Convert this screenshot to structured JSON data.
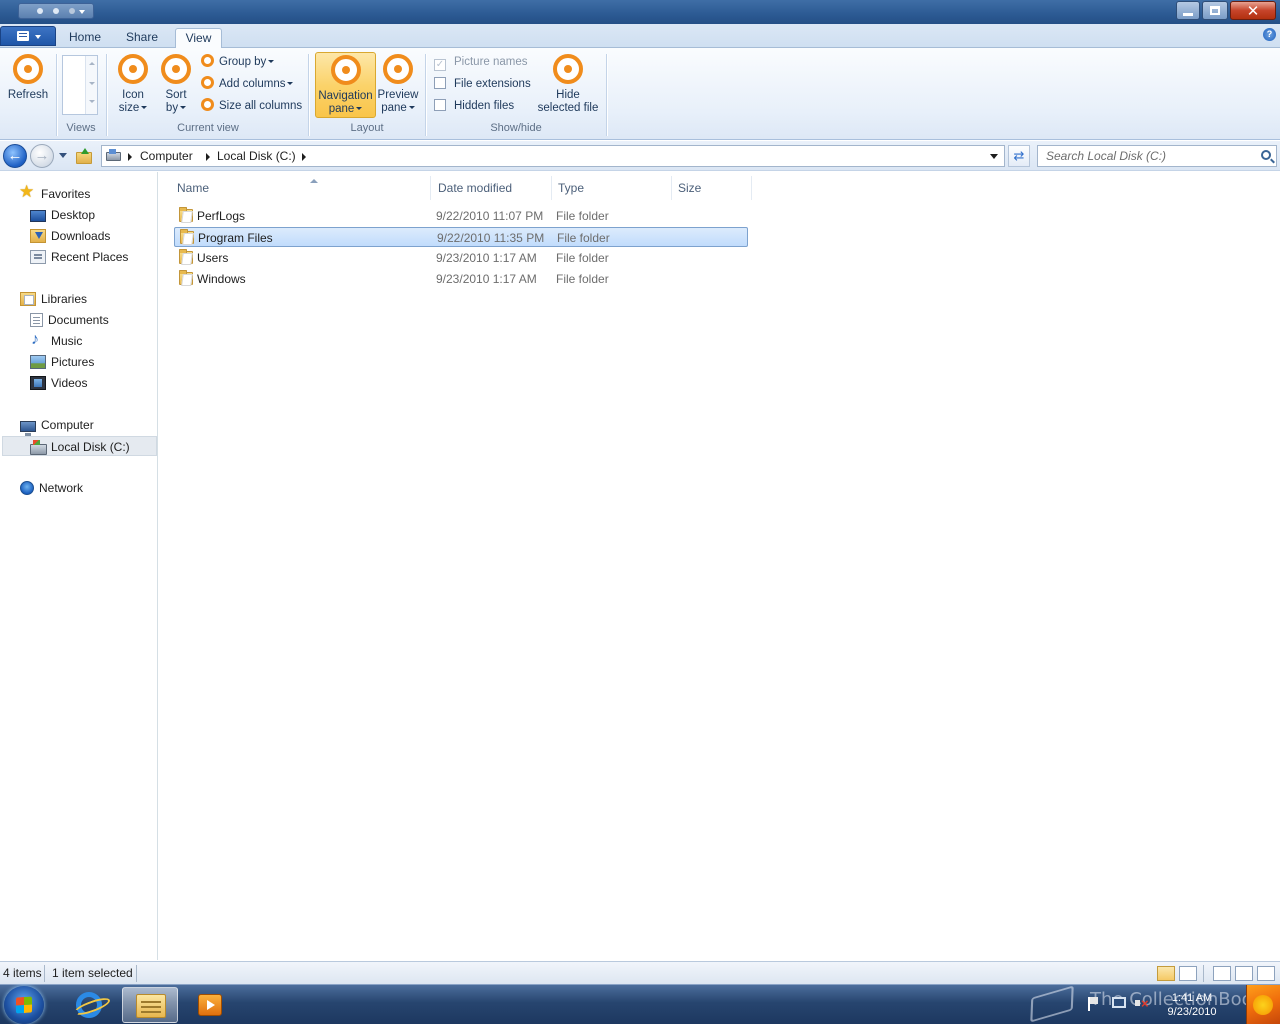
{
  "ribbon": {
    "tabs": [
      {
        "label": "Home"
      },
      {
        "label": "Share"
      },
      {
        "label": "View"
      }
    ],
    "help_glyph": "?",
    "groups": {
      "views_label": "Views",
      "current_view_label": "Current view",
      "layout_label": "Layout",
      "show_hide_label": "Show/hide"
    },
    "buttons": {
      "refresh": "Refresh",
      "icon_size_1": "Icon",
      "icon_size_2": "size",
      "sort_by_1": "Sort",
      "sort_by_2": "by",
      "group_by": "Group by",
      "add_columns": "Add columns",
      "size_all_columns": "Size all columns",
      "nav_pane_1": "Navigation",
      "nav_pane_2": "pane",
      "preview_pane_1": "Preview",
      "preview_pane_2": "pane",
      "hide_selected_1": "Hide",
      "hide_selected_2": "selected file"
    },
    "checkboxes": {
      "picture_names": "Picture names",
      "file_extensions": "File extensions",
      "hidden_files": "Hidden files"
    },
    "navigation_pane_active": true,
    "picture_names_checked": true,
    "picture_names_disabled": true
  },
  "address": {
    "crumbs": [
      "Computer",
      "Local Disk (C:)"
    ],
    "search_placeholder": "Search Local Disk (C:)"
  },
  "nav_pane": {
    "favorites": "Favorites",
    "desktop": "Desktop",
    "downloads": "Downloads",
    "recent_places": "Recent Places",
    "libraries": "Libraries",
    "documents": "Documents",
    "music": "Music",
    "pictures": "Pictures",
    "videos": "Videos",
    "computer": "Computer",
    "local_disk": "Local Disk (C:)",
    "network": "Network",
    "selected": "Local Disk (C:)"
  },
  "file_list": {
    "columns": [
      "Name",
      "Date modified",
      "Type",
      "Size"
    ],
    "rows": [
      {
        "name": "PerfLogs",
        "date": "9/22/2010 11:07 PM",
        "type": "File folder"
      },
      {
        "name": "Program Files",
        "date": "9/22/2010 11:35 PM",
        "type": "File folder",
        "selected": true
      },
      {
        "name": "Users",
        "date": "9/23/2010 1:17 AM",
        "type": "File folder"
      },
      {
        "name": "Windows",
        "date": "9/23/2010 1:17 AM",
        "type": "File folder"
      }
    ]
  },
  "status": {
    "items": "4 items",
    "selected": "1 item selected"
  },
  "taskbar": {
    "time": "1:41 AM",
    "date": "9/23/2010",
    "watermark": "The CollectionBook"
  },
  "colors": {
    "accent_orange": "#f08c1c",
    "selection_blue": "#c1dcfc",
    "active_button": "#fbd36b"
  }
}
